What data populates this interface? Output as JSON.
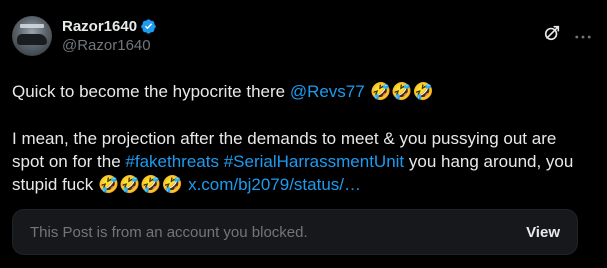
{
  "author": {
    "display_name": "Razor1640",
    "handle": "@Razor1640",
    "verified": true
  },
  "icons": {
    "verified": "verified-badge-icon",
    "grok": "grok-icon",
    "more": "more-icon"
  },
  "colors": {
    "link": "#1d9bf0",
    "secondary_text": "#71767b",
    "background": "#000000",
    "card_background": "#16181c"
  },
  "post": {
    "line1_prefix": "Quick to become the hypocrite there ",
    "mention": "@Revs77",
    "line1_emojis": " 🤣🤣🤣",
    "para2_part1": "I mean, the projection after the demands to meet & you pussying out are spot on for the ",
    "hashtag1": "#fakethreats",
    "space": " ",
    "hashtag2": "#SerialHarrassmentUnit",
    "para2_part2": " you hang around, you stupid fuck ",
    "para2_emojis": "🤣🤣🤣🤣 ",
    "link": "x.com/bj2079/status/…"
  },
  "quote": {
    "blocked_text": "This Post is from an account you blocked.",
    "view_label": "View"
  }
}
